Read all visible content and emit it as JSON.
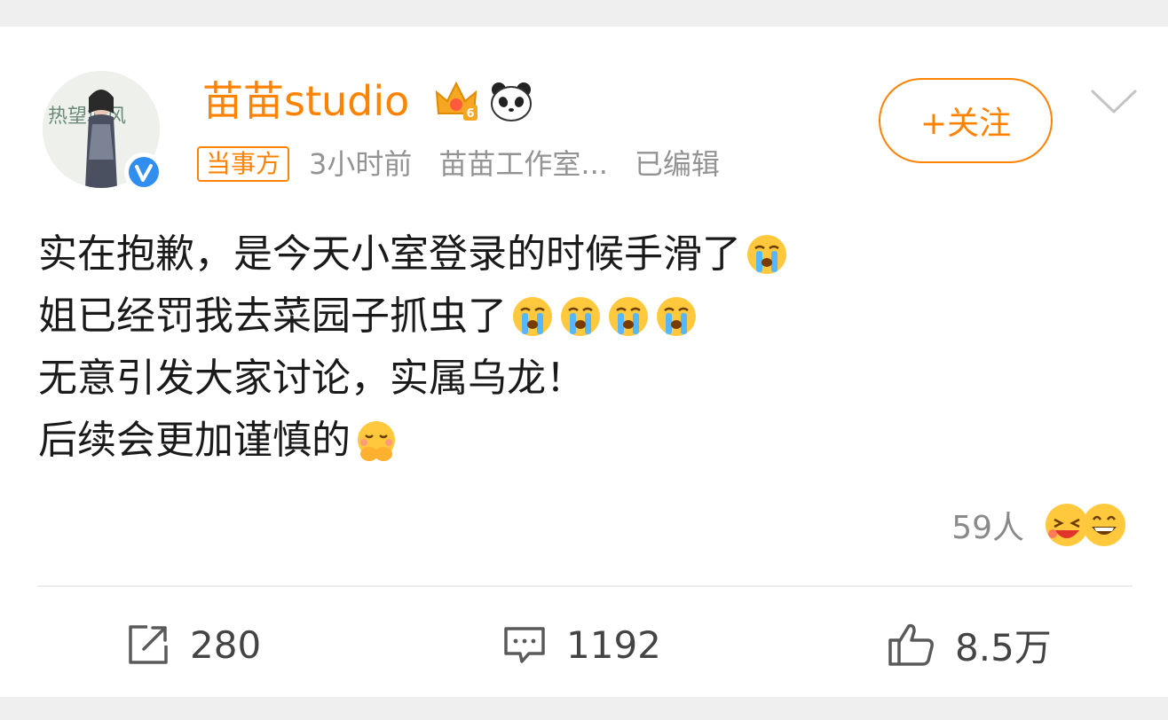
{
  "post": {
    "author": {
      "name": "苗苗studio",
      "avatar_text": "热望城风",
      "member_level": "6",
      "badges": [
        "crown-icon",
        "panda-icon"
      ],
      "verified": true
    },
    "meta": {
      "tag": "当事方",
      "time": "3小时前",
      "source": "苗苗工作室...",
      "edited": "已编辑"
    },
    "follow_label": "+关注",
    "body_lines": [
      "实在抱歉，是今天小室登录的时候手滑了",
      "姐已经罚我去菜园子抓虫了",
      "无意引发大家讨论，实属乌龙！",
      "后续会更加谨慎的"
    ],
    "reactions": {
      "count_label": "59人"
    },
    "actions": {
      "repost": "280",
      "comment": "1192",
      "like": "8.5万"
    }
  },
  "colors": {
    "brand_orange": "#ff8200",
    "meta_gray": "#939393",
    "text": "#1a1a1a"
  }
}
